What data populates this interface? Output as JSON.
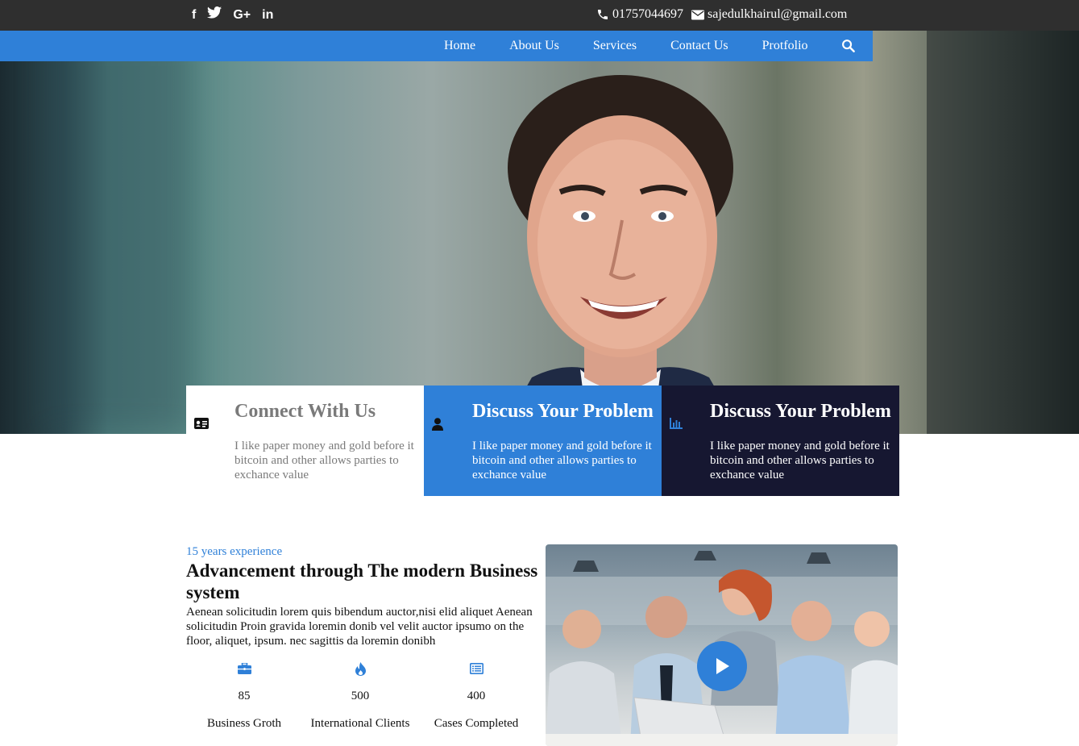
{
  "topbar": {
    "social": [
      {
        "name": "facebook-icon",
        "glyph": "f"
      },
      {
        "name": "twitter-icon",
        "glyph": "t"
      },
      {
        "name": "google-plus-icon",
        "glyph": "G+"
      },
      {
        "name": "linkedin-icon",
        "glyph": "in"
      }
    ],
    "phone": "01757044697",
    "email": "sajedulkhairul@gmail.com"
  },
  "nav": {
    "items": [
      "Home",
      "About Us",
      "Services",
      "Contact Us",
      "Protfolio"
    ],
    "search_icon": "search-icon"
  },
  "features": [
    {
      "icon": "id-card-icon",
      "title": "Connect With Us",
      "text": "I like paper money and gold before it bitcoin and other allows parties to exchance value"
    },
    {
      "icon": "user-icon",
      "title": "Discuss Your Problem",
      "text": "I like paper money and gold before it bitcoin and other allows parties to exchance value"
    },
    {
      "icon": "bar-chart-icon",
      "title": "Discuss Your Problem",
      "text": "I like paper money and gold before it bitcoin and other allows parties to exchance value"
    }
  ],
  "about": {
    "kicker": "15 years experience",
    "title": "Advancement through The modern Business system",
    "description": "Aenean solicitudin lorem quis bibendum auctor,nisi elid aliquet Aenean solicitudin Proin gravida loremin donib vel velit auctor ipsumo on the floor, aliquet, ipsum. nec sagittis da loremin donibh",
    "stats": [
      {
        "icon": "briefcase-icon",
        "value": "85",
        "label": "Business Groth"
      },
      {
        "icon": "fire-icon",
        "value": "500",
        "label": "International Clients"
      },
      {
        "icon": "list-icon",
        "value": "400",
        "label": "Cases Completed"
      }
    ]
  },
  "colors": {
    "accent": "#2f80d8",
    "dark_navy": "#161731",
    "topbar": "#2f2f2f"
  }
}
